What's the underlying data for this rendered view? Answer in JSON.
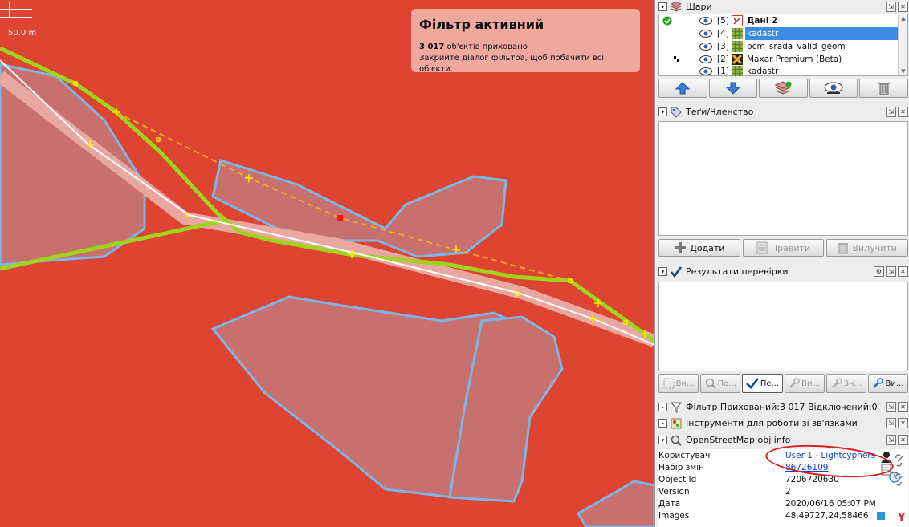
{
  "map": {
    "scale_label": "50.0 m",
    "filter_notice": {
      "title": "Фільтр активний",
      "count": "3 017",
      "hidden_text": " об'єктів приховано",
      "hint": "Закрийте діалог фільтра, щоб побачити всі об'єкти."
    },
    "colors": {
      "background": "#dd4431",
      "polygon_fill": "#c8706e",
      "polygon_edge": "#7db6e6",
      "road": "#9fd31d",
      "track": "#ffffff",
      "dashed": "#f5a623"
    }
  },
  "layers_panel": {
    "title": "Шари",
    "layers": [
      {
        "index": "[5]",
        "name": "Дані 2",
        "icon": "data-edit-icon",
        "bold": true,
        "selected": false,
        "active_check": true
      },
      {
        "index": "[4]",
        "name": "kadastr",
        "icon": "grid-layer-icon",
        "bold": false,
        "selected": true
      },
      {
        "index": "[3]",
        "name": "pcm_srada_valid_geom",
        "icon": "grid-layer-icon",
        "bold": false,
        "selected": false
      },
      {
        "index": "[2]",
        "name": "Maxar Premium (Beta)",
        "icon": "imagery-icon",
        "bold": false,
        "selected": false
      },
      {
        "index": "[1]",
        "name": "kadastr",
        "icon": "grid-layer-icon",
        "bold": false,
        "selected": false
      }
    ],
    "toolbar": [
      "move-up-icon",
      "move-down-icon",
      "activate-layer-icon",
      "toggle-visibility-icon",
      "delete-layer-icon"
    ]
  },
  "tags_panel": {
    "title": "Теґи/Членство",
    "add_label": "Додати",
    "edit_label": "Правити",
    "delete_label": "Вилучити"
  },
  "validation_panel": {
    "title": "Результати перевірки",
    "buttons": [
      {
        "label": "Ви...",
        "icon": "select-icon",
        "state": "disabled"
      },
      {
        "label": "По...",
        "icon": "zoom-icon",
        "state": "disabled"
      },
      {
        "label": "Пе...",
        "icon": "check-icon",
        "state": "active"
      },
      {
        "label": "Ви...",
        "icon": "wrench-icon",
        "state": "disabled"
      },
      {
        "label": "Зн...",
        "icon": "wrench-icon",
        "state": "disabled"
      },
      {
        "label": "Ви...",
        "icon": "wrench-blue-icon",
        "state": "normal"
      }
    ]
  },
  "filter_panel": {
    "title": "Фільтр Прихований:3 017 Відключений:0"
  },
  "relations_panel": {
    "title": "Інструменти для роботи зі зв'язками"
  },
  "osm_info_panel": {
    "title": "OpenStreetMap obj info",
    "rows": [
      {
        "key": "Користувач",
        "value": "User 1 - Lightcyphers",
        "style": "user"
      },
      {
        "key": "Набір змін",
        "value": "86726109",
        "style": "link"
      },
      {
        "key": "Object Id",
        "value": "7206720630",
        "style": "plain"
      },
      {
        "key": "Version",
        "value": "2",
        "style": "plain"
      },
      {
        "key": "Дата",
        "value": "2020/06/16 05:07 PM",
        "style": "plain"
      },
      {
        "key": "Images",
        "value": "48,49727,24,58466",
        "style": "plain"
      }
    ]
  }
}
